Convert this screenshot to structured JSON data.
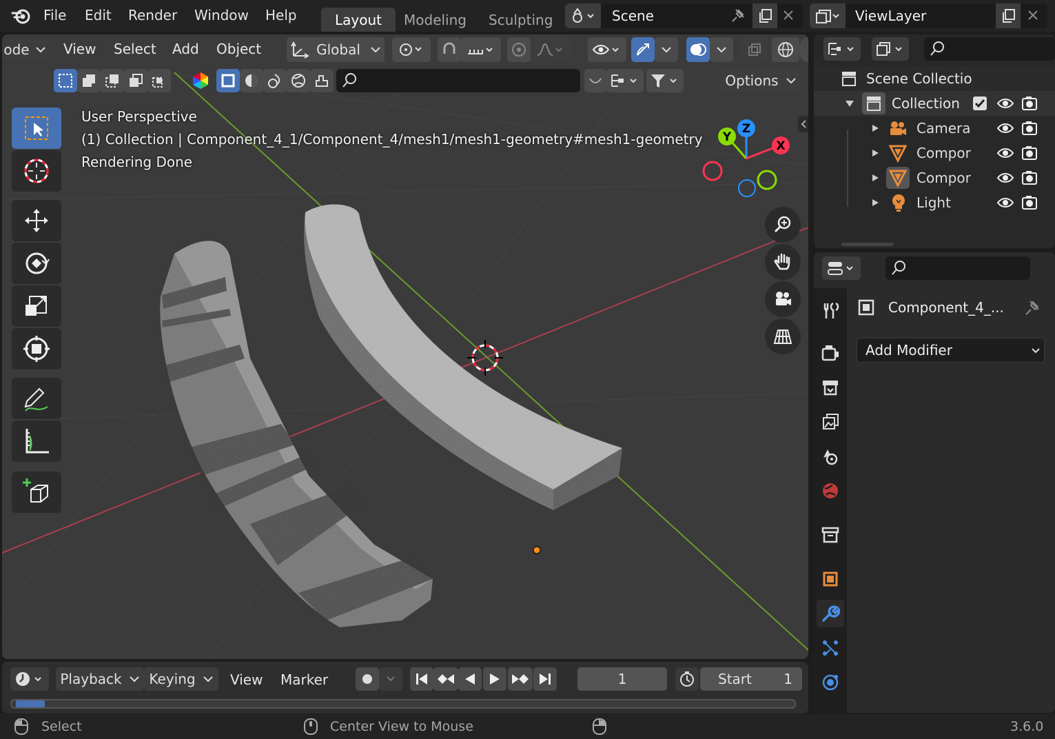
{
  "topbar": {
    "menus": [
      "File",
      "Edit",
      "Render",
      "Window",
      "Help"
    ],
    "workspaces": [
      "Layout",
      "Modeling",
      "Sculpting"
    ],
    "active_workspace": "Layout",
    "scene_name": "Scene",
    "view_layer": "ViewLayer"
  },
  "viewport": {
    "header": {
      "mode_label": "ode",
      "menus": [
        "View",
        "Select",
        "Add",
        "Object"
      ],
      "orientation": "Global",
      "options_label": "Options"
    },
    "overlay": {
      "line1": "User Perspective",
      "line2": "(1) Collection | Component_4_1/Component_4/mesh1/mesh1-geometry#mesh1-geometry",
      "line3": "Rendering Done"
    },
    "gizmo": {
      "x": "X",
      "y": "Y",
      "z": "Z"
    }
  },
  "outliner": {
    "root": "Scene Collectio",
    "collection": "Collection",
    "items": [
      {
        "label": "Camera",
        "type": "camera"
      },
      {
        "label": "Compor",
        "type": "mesh"
      },
      {
        "label": "Compor",
        "type": "mesh"
      },
      {
        "label": "Light",
        "type": "light"
      }
    ]
  },
  "properties": {
    "object_name": "Component_4_...",
    "add_modifier": "Add Modifier"
  },
  "timeline": {
    "menus": [
      "Playback",
      "Keying",
      "View",
      "Marker"
    ],
    "current_frame": "1",
    "start_label": "Start",
    "start_value": "1"
  },
  "statusbar": {
    "left": "Select",
    "middle": "Center View to Mouse",
    "version": "3.6.0"
  },
  "colors": {
    "accent": "#4772b3",
    "x_axis": "#ff3352",
    "y_axis": "#8bdc00",
    "z_axis": "#2890ff"
  }
}
